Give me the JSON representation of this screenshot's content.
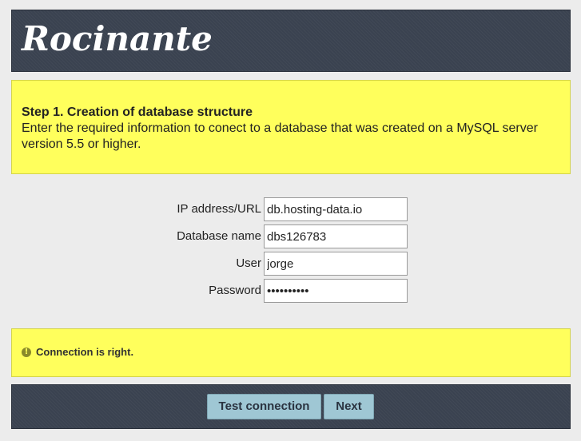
{
  "app": {
    "logo_text": "Rocinante"
  },
  "step": {
    "title": "Step 1. Creation of database structure",
    "description": "Enter the required information to conect to a database that was created on a MySQL server version 5.5 or higher."
  },
  "form": {
    "ip": {
      "label": "IP address/URL",
      "value": "db.hosting-data.io"
    },
    "dbname": {
      "label": "Database name",
      "value": "dbs126783"
    },
    "user": {
      "label": "User",
      "value": "jorge"
    },
    "password": {
      "label": "Password",
      "value": "••••••••••"
    }
  },
  "status": {
    "icon": "info-icon",
    "text": "Connection is right."
  },
  "buttons": {
    "test_label": "Test connection",
    "next_label": "Next"
  },
  "colors": {
    "header_bg": "#3a4250",
    "highlight_bg": "#ffff5c",
    "button_bg": "#9fc7d4"
  }
}
